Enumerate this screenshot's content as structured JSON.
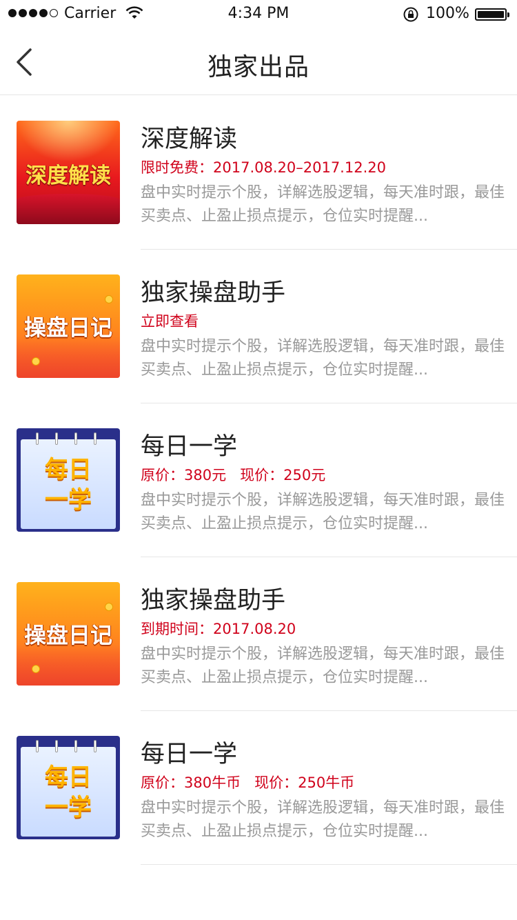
{
  "status_bar": {
    "carrier": "Carrier",
    "time": "4:34 PM",
    "battery_percent": "100%"
  },
  "nav": {
    "title": "独家出品",
    "back_icon": "chevron-left-icon"
  },
  "items": [
    {
      "thumb_label": "深度解读",
      "title": "深度解读",
      "sub": "限时免费：2017.08.20–2017.12.20",
      "desc": "盘中实时提示个股，详解选股逻辑，每天准时跟，最佳买卖点、止盈止损点提示，仓位实时提醒..."
    },
    {
      "thumb_label": "操盘日记",
      "title": "独家操盘助手",
      "sub": "立即查看",
      "desc": "盘中实时提示个股，详解选股逻辑，每天准时跟，最佳买卖点、止盈止损点提示，仓位实时提醒..."
    },
    {
      "thumb_label": "每日一学",
      "title": "每日一学",
      "sub": "原价：380元   现价：250元",
      "desc": "盘中实时提示个股，详解选股逻辑，每天准时跟，最佳买卖点、止盈止损点提示，仓位实时提醒..."
    },
    {
      "thumb_label": "操盘日记",
      "title": "独家操盘助手",
      "sub": "到期时间：2017.08.20",
      "desc": "盘中实时提示个股，详解选股逻辑，每天准时跟，最佳买卖点、止盈止损点提示，仓位实时提醒..."
    },
    {
      "thumb_label": "每日一学",
      "title": "每日一学",
      "sub": "原价：380牛币   现价：250牛币",
      "desc": "盘中实时提示个股，详解选股逻辑，每天准时跟，最佳买卖点、止盈止损点提示，仓位实时提醒..."
    }
  ],
  "colors": {
    "accent_red": "#d0021b",
    "title_text": "#222222",
    "desc_text": "#999999",
    "divider": "#e6e6e6"
  }
}
